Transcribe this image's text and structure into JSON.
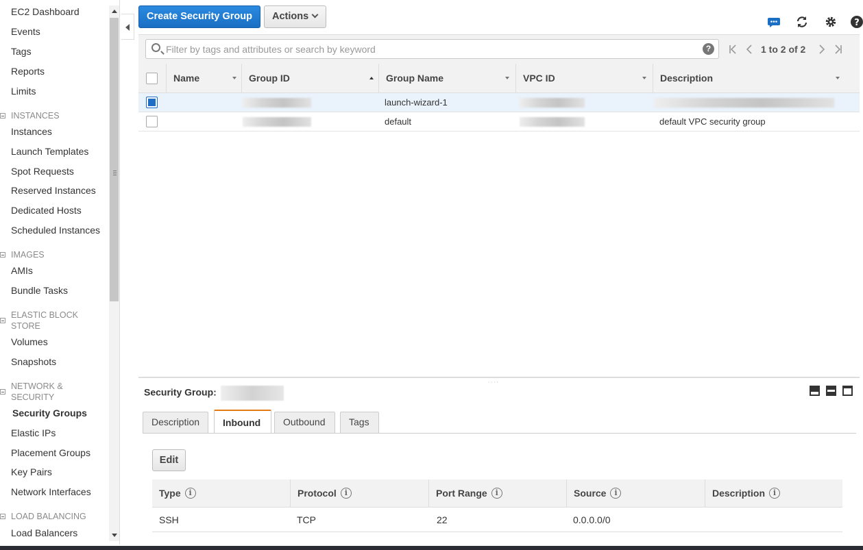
{
  "sidebar": {
    "items": [
      {
        "label": "EC2 Dashboard"
      },
      {
        "label": "Events"
      },
      {
        "label": "Tags"
      },
      {
        "label": "Reports"
      },
      {
        "label": "Limits"
      }
    ],
    "sections": {
      "instances": {
        "title": "INSTANCES",
        "items": [
          "Instances",
          "Launch Templates",
          "Spot Requests",
          "Reserved Instances",
          "Dedicated Hosts",
          "Scheduled Instances"
        ]
      },
      "images": {
        "title": "IMAGES",
        "items": [
          "AMIs",
          "Bundle Tasks"
        ]
      },
      "ebs": {
        "title": "ELASTIC BLOCK STORE",
        "items": [
          "Volumes",
          "Snapshots"
        ]
      },
      "network": {
        "title": "NETWORK & SECURITY",
        "items": [
          "Security Groups",
          "Elastic IPs",
          "Placement Groups",
          "Key Pairs",
          "Network Interfaces"
        ]
      },
      "lb": {
        "title": "LOAD BALANCING",
        "items": [
          "Load Balancers"
        ]
      }
    },
    "active_item": "Security Groups"
  },
  "toolbar": {
    "create_label": "Create Security Group",
    "actions_label": "Actions"
  },
  "filter": {
    "placeholder": "Filter by tags and attributes or search by keyword",
    "help": "?"
  },
  "pager": {
    "text": "1 to 2 of 2"
  },
  "grid": {
    "columns": [
      "Name",
      "Group ID",
      "Group Name",
      "VPC ID",
      "Description"
    ],
    "rows": [
      {
        "name": "",
        "group_name": "launch-wizard-1",
        "description": "",
        "selected": true
      },
      {
        "name": "",
        "group_name": "default",
        "description": "default VPC security group",
        "selected": false
      }
    ]
  },
  "detail": {
    "title": "Security Group:",
    "tabs": [
      "Description",
      "Inbound",
      "Outbound",
      "Tags"
    ],
    "active_tab": "Inbound",
    "edit_label": "Edit",
    "rule_columns": [
      "Type",
      "Protocol",
      "Port Range",
      "Source",
      "Description"
    ],
    "rules": [
      {
        "type": "SSH",
        "protocol": "TCP",
        "port_range": "22",
        "source": "0.0.0.0/0",
        "description": ""
      }
    ]
  },
  "colors": {
    "primary": "#1a6fc4",
    "tab_accent": "#e47911",
    "selected_row": "#eaf2fb"
  }
}
